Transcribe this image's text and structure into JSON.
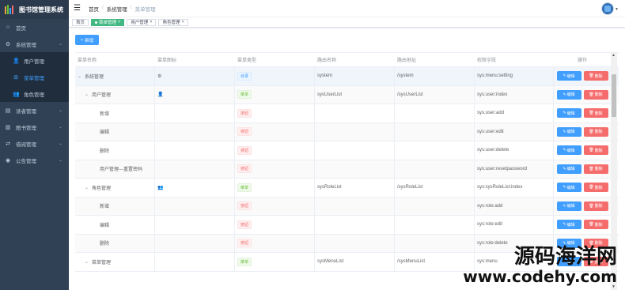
{
  "app": {
    "title": "图书馆管理系统"
  },
  "sidebar": {
    "items": [
      {
        "label": "首页",
        "icon": "dashboard-icon",
        "sub": false,
        "arrow": false
      },
      {
        "label": "系统管理",
        "icon": "gear-icon",
        "sub": false,
        "arrow": true
      },
      {
        "label": "用户管理",
        "icon": "user-icon",
        "sub": true,
        "arrow": false
      },
      {
        "label": "菜单管理",
        "icon": "tree-icon",
        "sub": true,
        "arrow": false,
        "active": true
      },
      {
        "label": "角色管理",
        "icon": "peoples-icon",
        "sub": true,
        "arrow": false
      },
      {
        "label": "读者管理",
        "icon": "reader-icon",
        "sub": false,
        "arrow": true
      },
      {
        "label": "图书管理",
        "icon": "book-icon",
        "sub": false,
        "arrow": true
      },
      {
        "label": "借阅管理",
        "icon": "borrow-icon",
        "sub": false,
        "arrow": true
      },
      {
        "label": "公告管理",
        "icon": "notice-icon",
        "sub": false,
        "arrow": true
      }
    ]
  },
  "breadcrumb": [
    "首页",
    "系统管理",
    "菜单管理"
  ],
  "tags": [
    {
      "label": "首页",
      "active": false,
      "closable": false
    },
    {
      "label": "菜单管理",
      "active": true,
      "closable": true
    },
    {
      "label": "用户管理",
      "active": false,
      "closable": true
    },
    {
      "label": "角色管理",
      "active": false,
      "closable": true
    }
  ],
  "toolbar": {
    "add_label": "新增"
  },
  "table": {
    "headers": [
      "菜单名称",
      "菜单图标",
      "菜单类型",
      "路由名称",
      "路由地址",
      "权限字段",
      "操作"
    ],
    "edit_label": "编辑",
    "delete_label": "删除",
    "rows": [
      {
        "name": "系统管理",
        "level": 0,
        "expand": true,
        "icon": "⚙",
        "type": "目录",
        "kind": "dir",
        "route_name": "system",
        "route_path": "/system",
        "perm": "sys:menu:setting"
      },
      {
        "name": "用户管理",
        "level": 1,
        "expand": true,
        "icon": "👤",
        "type": "菜单",
        "kind": "menu",
        "route_name": "sysUserList",
        "route_path": "/sysUserList",
        "perm": "sys:user:index"
      },
      {
        "name": "新增",
        "level": 2,
        "expand": false,
        "icon": "",
        "type": "按钮",
        "kind": "btn",
        "route_name": "",
        "route_path": "",
        "perm": "sys:user:add"
      },
      {
        "name": "编辑",
        "level": 2,
        "expand": false,
        "icon": "",
        "type": "按钮",
        "kind": "btn",
        "route_name": "",
        "route_path": "",
        "perm": "sys:user:edit"
      },
      {
        "name": "删除",
        "level": 2,
        "expand": false,
        "icon": "",
        "type": "按钮",
        "kind": "btn",
        "route_name": "",
        "route_path": "",
        "perm": "sys:user:delete"
      },
      {
        "name": "用户管理---重置密码",
        "level": 2,
        "expand": false,
        "icon": "",
        "type": "按钮",
        "kind": "btn",
        "route_name": "",
        "route_path": "",
        "perm": "sys:user:resetpassword"
      },
      {
        "name": "角色管理",
        "level": 1,
        "expand": true,
        "icon": "👥",
        "type": "菜单",
        "kind": "menu",
        "route_name": "sysRoleList",
        "route_path": "/sysRoleList",
        "perm": "sys:sysRoleList:index"
      },
      {
        "name": "新增",
        "level": 2,
        "expand": false,
        "icon": "",
        "type": "按钮",
        "kind": "btn",
        "route_name": "",
        "route_path": "",
        "perm": "sys:role:add"
      },
      {
        "name": "编辑",
        "level": 2,
        "expand": false,
        "icon": "",
        "type": "按钮",
        "kind": "btn",
        "route_name": "",
        "route_path": "",
        "perm": "sys:role:edit"
      },
      {
        "name": "删除",
        "level": 2,
        "expand": false,
        "icon": "",
        "type": "按钮",
        "kind": "btn",
        "route_name": "",
        "route_path": "",
        "perm": "sys:role:delete"
      },
      {
        "name": "菜单管理",
        "level": 1,
        "expand": true,
        "icon": "",
        "type": "菜单",
        "kind": "menu",
        "route_name": "sysMenuList",
        "route_path": "/sysMenuList",
        "perm": "sys:menu"
      }
    ]
  },
  "watermark": {
    "cn": "源码海洋网",
    "url": "www.codehy.com"
  },
  "colors": {
    "sidebar_bg": "#304156",
    "primary": "#409eff",
    "danger": "#f56c6c",
    "success": "#67c23a",
    "tag_active": "#42b983"
  }
}
